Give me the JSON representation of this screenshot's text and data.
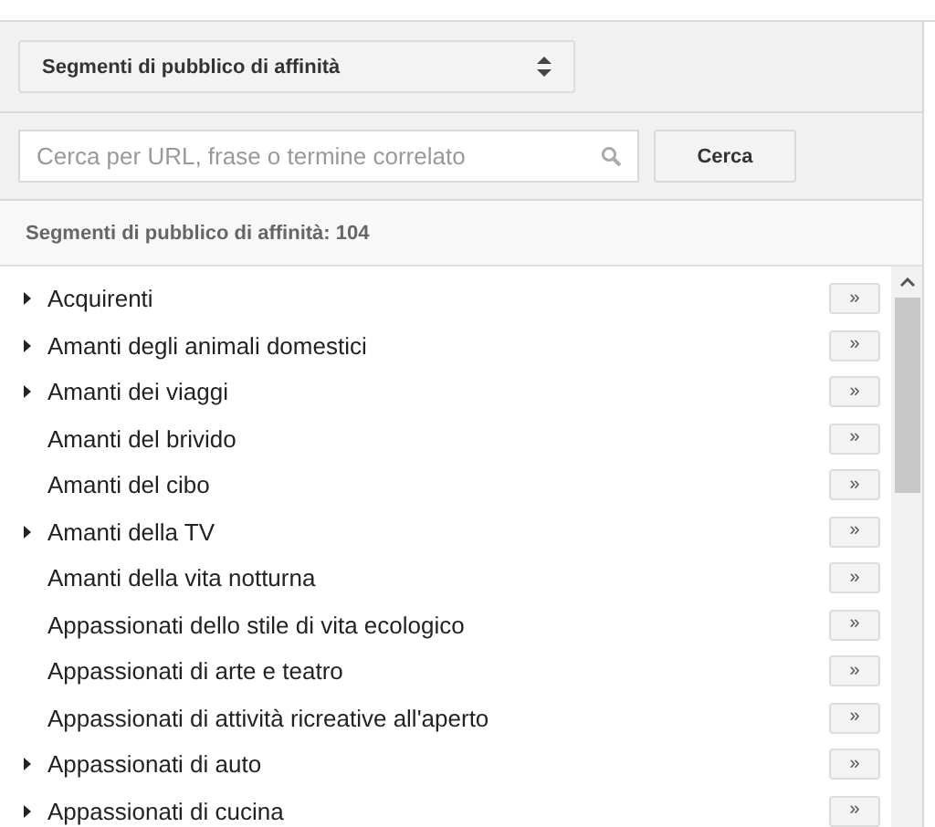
{
  "dropdown": {
    "value": "Segmenti di pubblico di affinità"
  },
  "search": {
    "placeholder": "Cerca per URL, frase o termine correlato",
    "button": "Cerca"
  },
  "count_label": "Segmenti di pubblico di affinità: 104",
  "items": [
    {
      "label": "Acquirenti",
      "expandable": true,
      "action": "»"
    },
    {
      "label": "Amanti degli animali domestici",
      "expandable": true,
      "action": "»"
    },
    {
      "label": "Amanti dei viaggi",
      "expandable": true,
      "action": "»"
    },
    {
      "label": "Amanti del brivido",
      "expandable": false,
      "action": "»"
    },
    {
      "label": "Amanti del cibo",
      "expandable": false,
      "action": "»"
    },
    {
      "label": "Amanti della TV",
      "expandable": true,
      "action": "»"
    },
    {
      "label": "Amanti della vita notturna",
      "expandable": false,
      "action": "»"
    },
    {
      "label": "Appassionati dello stile di vita ecologico",
      "expandable": false,
      "action": "»"
    },
    {
      "label": "Appassionati di arte e teatro",
      "expandable": false,
      "action": "»"
    },
    {
      "label": "Appassionati di attività ricreative all'aperto",
      "expandable": false,
      "action": "»"
    },
    {
      "label": "Appassionati di auto",
      "expandable": true,
      "action": "»"
    },
    {
      "label": "Appassionati di cucina",
      "expandable": true,
      "action": "»"
    }
  ]
}
